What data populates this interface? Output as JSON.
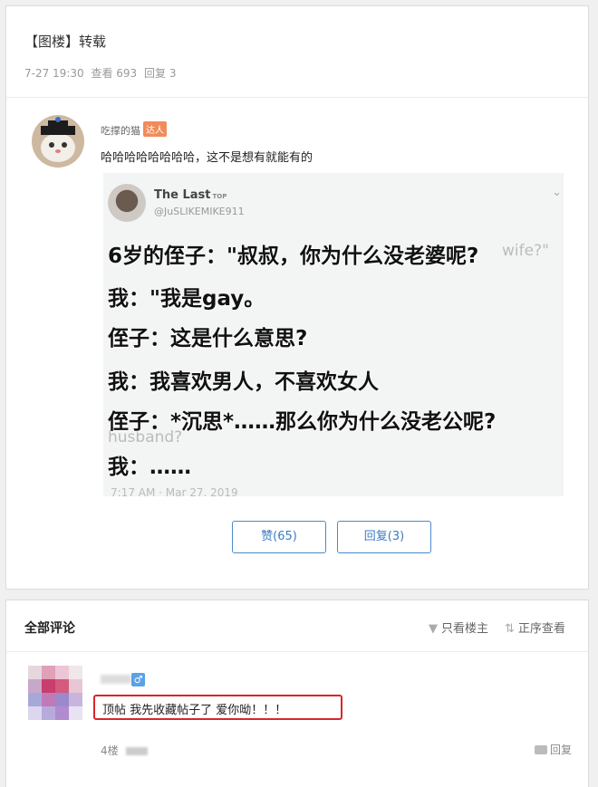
{
  "post": {
    "title": "【图楼】转载",
    "meta": {
      "time": "7-27 19:30",
      "views": "查看 693",
      "replies": "回复 3"
    },
    "author": {
      "name": "吃撑的猫",
      "badge": "达人"
    },
    "text": "哈哈哈哈哈哈哈哈，这不是想有就能有的",
    "tweet": {
      "name": "The Last",
      "top_mark": "TOP",
      "handle": "@JuSLIKEMIKE911",
      "lines": [
        "6岁的侄子：\"叔叔，你为什么没老婆呢?",
        "我：\"我是gay。",
        "侄子：这是什么意思?",
        "我：我喜欢男人，不喜欢女人",
        "侄子：*沉思*……那么你为什么没老公呢?",
        "我：……"
      ],
      "ghost_wife": "wife?\"",
      "ghost_husband": "husband?",
      "time": "7:17 AM · Mar 27, 2019"
    },
    "buttons": {
      "like": "赞(65)",
      "reply": "回复(3)"
    }
  },
  "comments": {
    "header": "全部评论",
    "filter_owner": "只看楼主",
    "filter_order": "正序查看",
    "items": [
      {
        "gender_icon": "male-icon",
        "text": "顶帖 我先收藏帖子了 爱你呦！！！",
        "floor": "4楼",
        "reply": "回复"
      }
    ]
  },
  "colors": {
    "accent": "#3a7cc0",
    "badge": "#f08c5a",
    "highlight_border": "#d9262a"
  }
}
